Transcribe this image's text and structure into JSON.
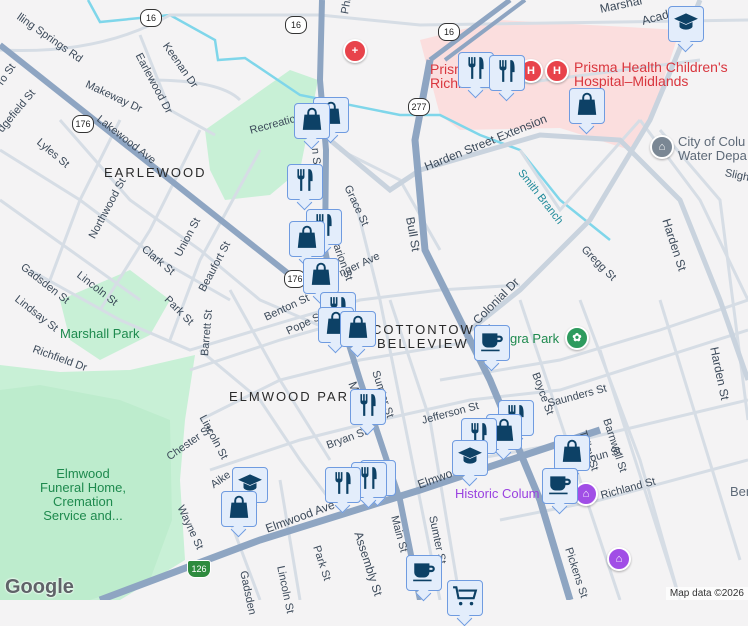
{
  "neighborhoods": [
    "EARLEWOOD",
    "ELMWOOD PARK",
    "COTTONTOWN/",
    "BELLEVIEW"
  ],
  "parks": {
    "marshall": "Marshall Park",
    "elmwood": [
      "Elmwood",
      "Funeral Home,",
      "Cremation",
      "Service and..."
    ],
    "finlay": "gra Park"
  },
  "hospitals": {
    "richland": [
      "Prisma",
      "Richland"
    ],
    "childrens": [
      "Prisma Health Children's",
      "Hospital–Midlands"
    ]
  },
  "poi": {
    "water": [
      "City of Colu",
      "Water Depa"
    ],
    "historic": "Historic Colum",
    "ben": "Ben"
  },
  "streets": {
    "rolling": "lling Springs Rd",
    "earlewood_dr": "Earlewood Dr",
    "keenan": "Keenan Dr",
    "makeway": "Makeway Dr",
    "lakewood": "Lakewood Ave",
    "lyles": "Lyles St",
    "edgefield": "dgefield St",
    "oro": "ro St",
    "northwood": "Northwood St",
    "clark": "Clark St",
    "union": "Union St",
    "beaufort": "Beaufort St",
    "gadsden": "Gadsden St",
    "lincoln": "Lincoln St",
    "lindsay": "Lindsay St",
    "park": "Park St",
    "richfield": "Richfield Dr",
    "barrett": "Barrett St",
    "benton": "Benton St",
    "pope": "Pope St",
    "recreation": "Recreation",
    "main_st": "n St",
    "grace": "Grace St",
    "marion": "Marion St",
    "sanger": "nger Ave",
    "chester": "Chester St",
    "lincoln2": "Lincoln St",
    "aiken": "Aike",
    "wayne": "Wayne St",
    "bryan": "Bryan St",
    "elmwood_ave": "Elmwood Ave",
    "elmwood_ave2": "Elmwo",
    "assembly": "Assembly St",
    "park2": "Park St",
    "lincoln3": "Lincoln St",
    "gadsden2": "Gadsden",
    "main2": "Main St",
    "sumter": "Sumter St",
    "sumter2": "Sumter St",
    "jefferson": "Jefferson St",
    "m": "M",
    "bull": "Bull St",
    "harden_ext": "Harden Street Extension",
    "smith": "Smith Branch",
    "harden": "Harden St",
    "harden2": "Harden St",
    "gregg": "Gregg St",
    "colonial": "Colonial Dr",
    "marshall": "Marshal",
    "academy": "Acad",
    "slight": "Sligh",
    "boyce": "Boyce St",
    "saunders": "Saunders St",
    "talley": "Talley St",
    "barnwell": "Barnwell St",
    "calhoun": "lhoun St",
    "richland": "Richland St",
    "pickens": "Pickens St",
    "phi": "Phi"
  },
  "shields": {
    "sc16": "16",
    "us176": "176",
    "us277": "277",
    "i126": "126"
  },
  "attribution": {
    "logo": "Google",
    "credit": "Map data ©2026"
  },
  "colors": {
    "highway": "#8ea5c2",
    "road": "#d6dde5",
    "park": "#c8f0d6",
    "hospital": "#fbdede",
    "water": "#7fd6ea",
    "marker_icon": "#0d4166"
  }
}
